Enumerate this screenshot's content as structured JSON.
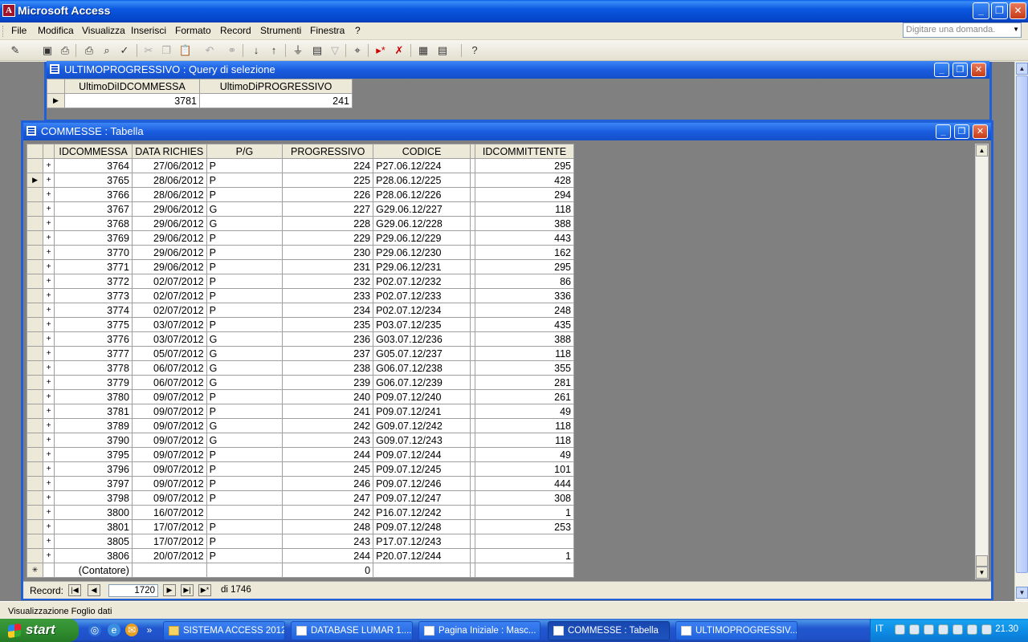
{
  "app": {
    "title": "Microsoft Access",
    "window_buttons": {
      "minimize": "_",
      "restore": "❐",
      "close": "✕"
    }
  },
  "menu": {
    "items": [
      "File",
      "Modifica",
      "Visualizza",
      "Inserisci",
      "Formato",
      "Record",
      "Strumenti",
      "Finestra",
      "?"
    ],
    "ask_placeholder": "Digitare una domanda."
  },
  "toolbar": {
    "icons": [
      "view-icon",
      "save-icon",
      "print-preview-icon",
      "print-icon",
      "preview-icon",
      "spelling-icon",
      "cut-icon",
      "copy-icon",
      "paste-icon",
      "undo-icon",
      "hyperlink-icon",
      "sort-ascending-icon",
      "sort-descending-icon",
      "filter-by-selection-icon",
      "filter-by-form-icon",
      "apply-filter-icon",
      "find-icon",
      "new-record-icon",
      "delete-record-icon",
      "database-window-icon",
      "new-object-icon",
      "help-icon"
    ]
  },
  "query_window": {
    "title": "ULTIMOPROGRESSIVO : Query di selezione",
    "columns": [
      "UltimoDiIDCOMMESSA",
      "UltimoDiPROGRESSIVO"
    ],
    "row": [
      "3781",
      "241"
    ]
  },
  "table_window": {
    "title": "COMMESSE : Tabella",
    "columns": [
      "IDCOMMESSA",
      "DATA RICHIES",
      "P/G",
      "PROGRESSIVO",
      "CODICE",
      "IDCOMMITTENTE"
    ],
    "rows": [
      [
        "3764",
        "27/06/2012",
        "P",
        "224",
        "P27.06.12/224",
        "295"
      ],
      [
        "3765",
        "28/06/2012",
        "P",
        "225",
        "P28.06.12/225",
        "428"
      ],
      [
        "3766",
        "28/06/2012",
        "P",
        "226",
        "P28.06.12/226",
        "294"
      ],
      [
        "3767",
        "29/06/2012",
        "G",
        "227",
        "G29.06.12/227",
        "118"
      ],
      [
        "3768",
        "29/06/2012",
        "G",
        "228",
        "G29.06.12/228",
        "388"
      ],
      [
        "3769",
        "29/06/2012",
        "P",
        "229",
        "P29.06.12/229",
        "443"
      ],
      [
        "3770",
        "29/06/2012",
        "P",
        "230",
        "P29.06.12/230",
        "162"
      ],
      [
        "3771",
        "29/06/2012",
        "P",
        "231",
        "P29.06.12/231",
        "295"
      ],
      [
        "3772",
        "02/07/2012",
        "P",
        "232",
        "P02.07.12/232",
        "86"
      ],
      [
        "3773",
        "02/07/2012",
        "P",
        "233",
        "P02.07.12/233",
        "336"
      ],
      [
        "3774",
        "02/07/2012",
        "P",
        "234",
        "P02.07.12/234",
        "248"
      ],
      [
        "3775",
        "03/07/2012",
        "P",
        "235",
        "P03.07.12/235",
        "435"
      ],
      [
        "3776",
        "03/07/2012",
        "G",
        "236",
        "G03.07.12/236",
        "388"
      ],
      [
        "3777",
        "05/07/2012",
        "G",
        "237",
        "G05.07.12/237",
        "118"
      ],
      [
        "3778",
        "06/07/2012",
        "G",
        "238",
        "G06.07.12/238",
        "355"
      ],
      [
        "3779",
        "06/07/2012",
        "G",
        "239",
        "G06.07.12/239",
        "281"
      ],
      [
        "3780",
        "09/07/2012",
        "P",
        "240",
        "P09.07.12/240",
        "261"
      ],
      [
        "3781",
        "09/07/2012",
        "P",
        "241",
        "P09.07.12/241",
        "49"
      ],
      [
        "3789",
        "09/07/2012",
        "G",
        "242",
        "G09.07.12/242",
        "118"
      ],
      [
        "3790",
        "09/07/2012",
        "G",
        "243",
        "G09.07.12/243",
        "118"
      ],
      [
        "3795",
        "09/07/2012",
        "P",
        "244",
        "P09.07.12/244",
        "49"
      ],
      [
        "3796",
        "09/07/2012",
        "P",
        "245",
        "P09.07.12/245",
        "101"
      ],
      [
        "3797",
        "09/07/2012",
        "P",
        "246",
        "P09.07.12/246",
        "444"
      ],
      [
        "3798",
        "09/07/2012",
        "P",
        "247",
        "P09.07.12/247",
        "308"
      ],
      [
        "3800",
        "16/07/2012",
        "",
        "242",
        "P16.07.12/242",
        "1"
      ],
      [
        "3801",
        "17/07/2012",
        "P",
        "248",
        "P09.07.12/248",
        "253"
      ],
      [
        "3805",
        "17/07/2012",
        "P",
        "243",
        "P17.07.12/243",
        ""
      ],
      [
        "3806",
        "20/07/2012",
        "P",
        "244",
        "P20.07.12/244",
        "1"
      ]
    ],
    "current_row_index": 1,
    "new_row": {
      "id": "(Contatore)",
      "progressivo": "0"
    },
    "nav": {
      "label": "Record:",
      "current": "1720",
      "total": "di 1746"
    }
  },
  "status_bar": "Visualizzazione Foglio dati",
  "taskbar": {
    "start": "start",
    "items": [
      {
        "label": "SISTEMA ACCESS 2012",
        "icon": "folder-icon"
      },
      {
        "label": "DATABASE LUMAR 1....",
        "icon": "database-icon"
      },
      {
        "label": "Pagina Iniziale : Masc...",
        "icon": "form-icon"
      },
      {
        "label": "COMMESSE : Tabella",
        "icon": "table-icon"
      },
      {
        "label": "ULTIMOPROGRESSIV...",
        "icon": "query-icon"
      }
    ],
    "active_index": 3,
    "tray": {
      "lang": "IT",
      "clock": "21.30"
    }
  }
}
